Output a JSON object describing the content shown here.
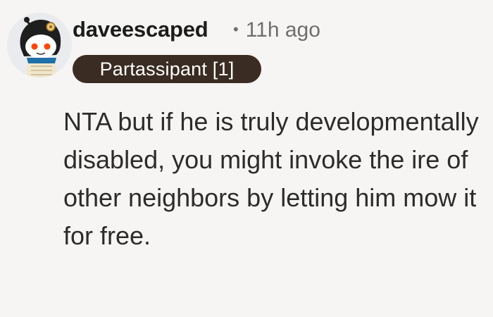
{
  "comment": {
    "author": "daveescaped",
    "separator": "•",
    "timestamp": "11h ago",
    "flair": "Partassipant [1]",
    "body": "NTA but if he is truly developmentally disabled, you might invoke the ire of other neighbors by letting him mow it for free.",
    "avatar_icon": "snoo-avatar-icon"
  },
  "colors": {
    "background": "#f6f5f3",
    "flair_background": "#3a2c22",
    "flair_text": "#ffffff",
    "username": "#1c1c1c",
    "meta": "#6e6e6e",
    "body_text": "#2c2c2c"
  }
}
